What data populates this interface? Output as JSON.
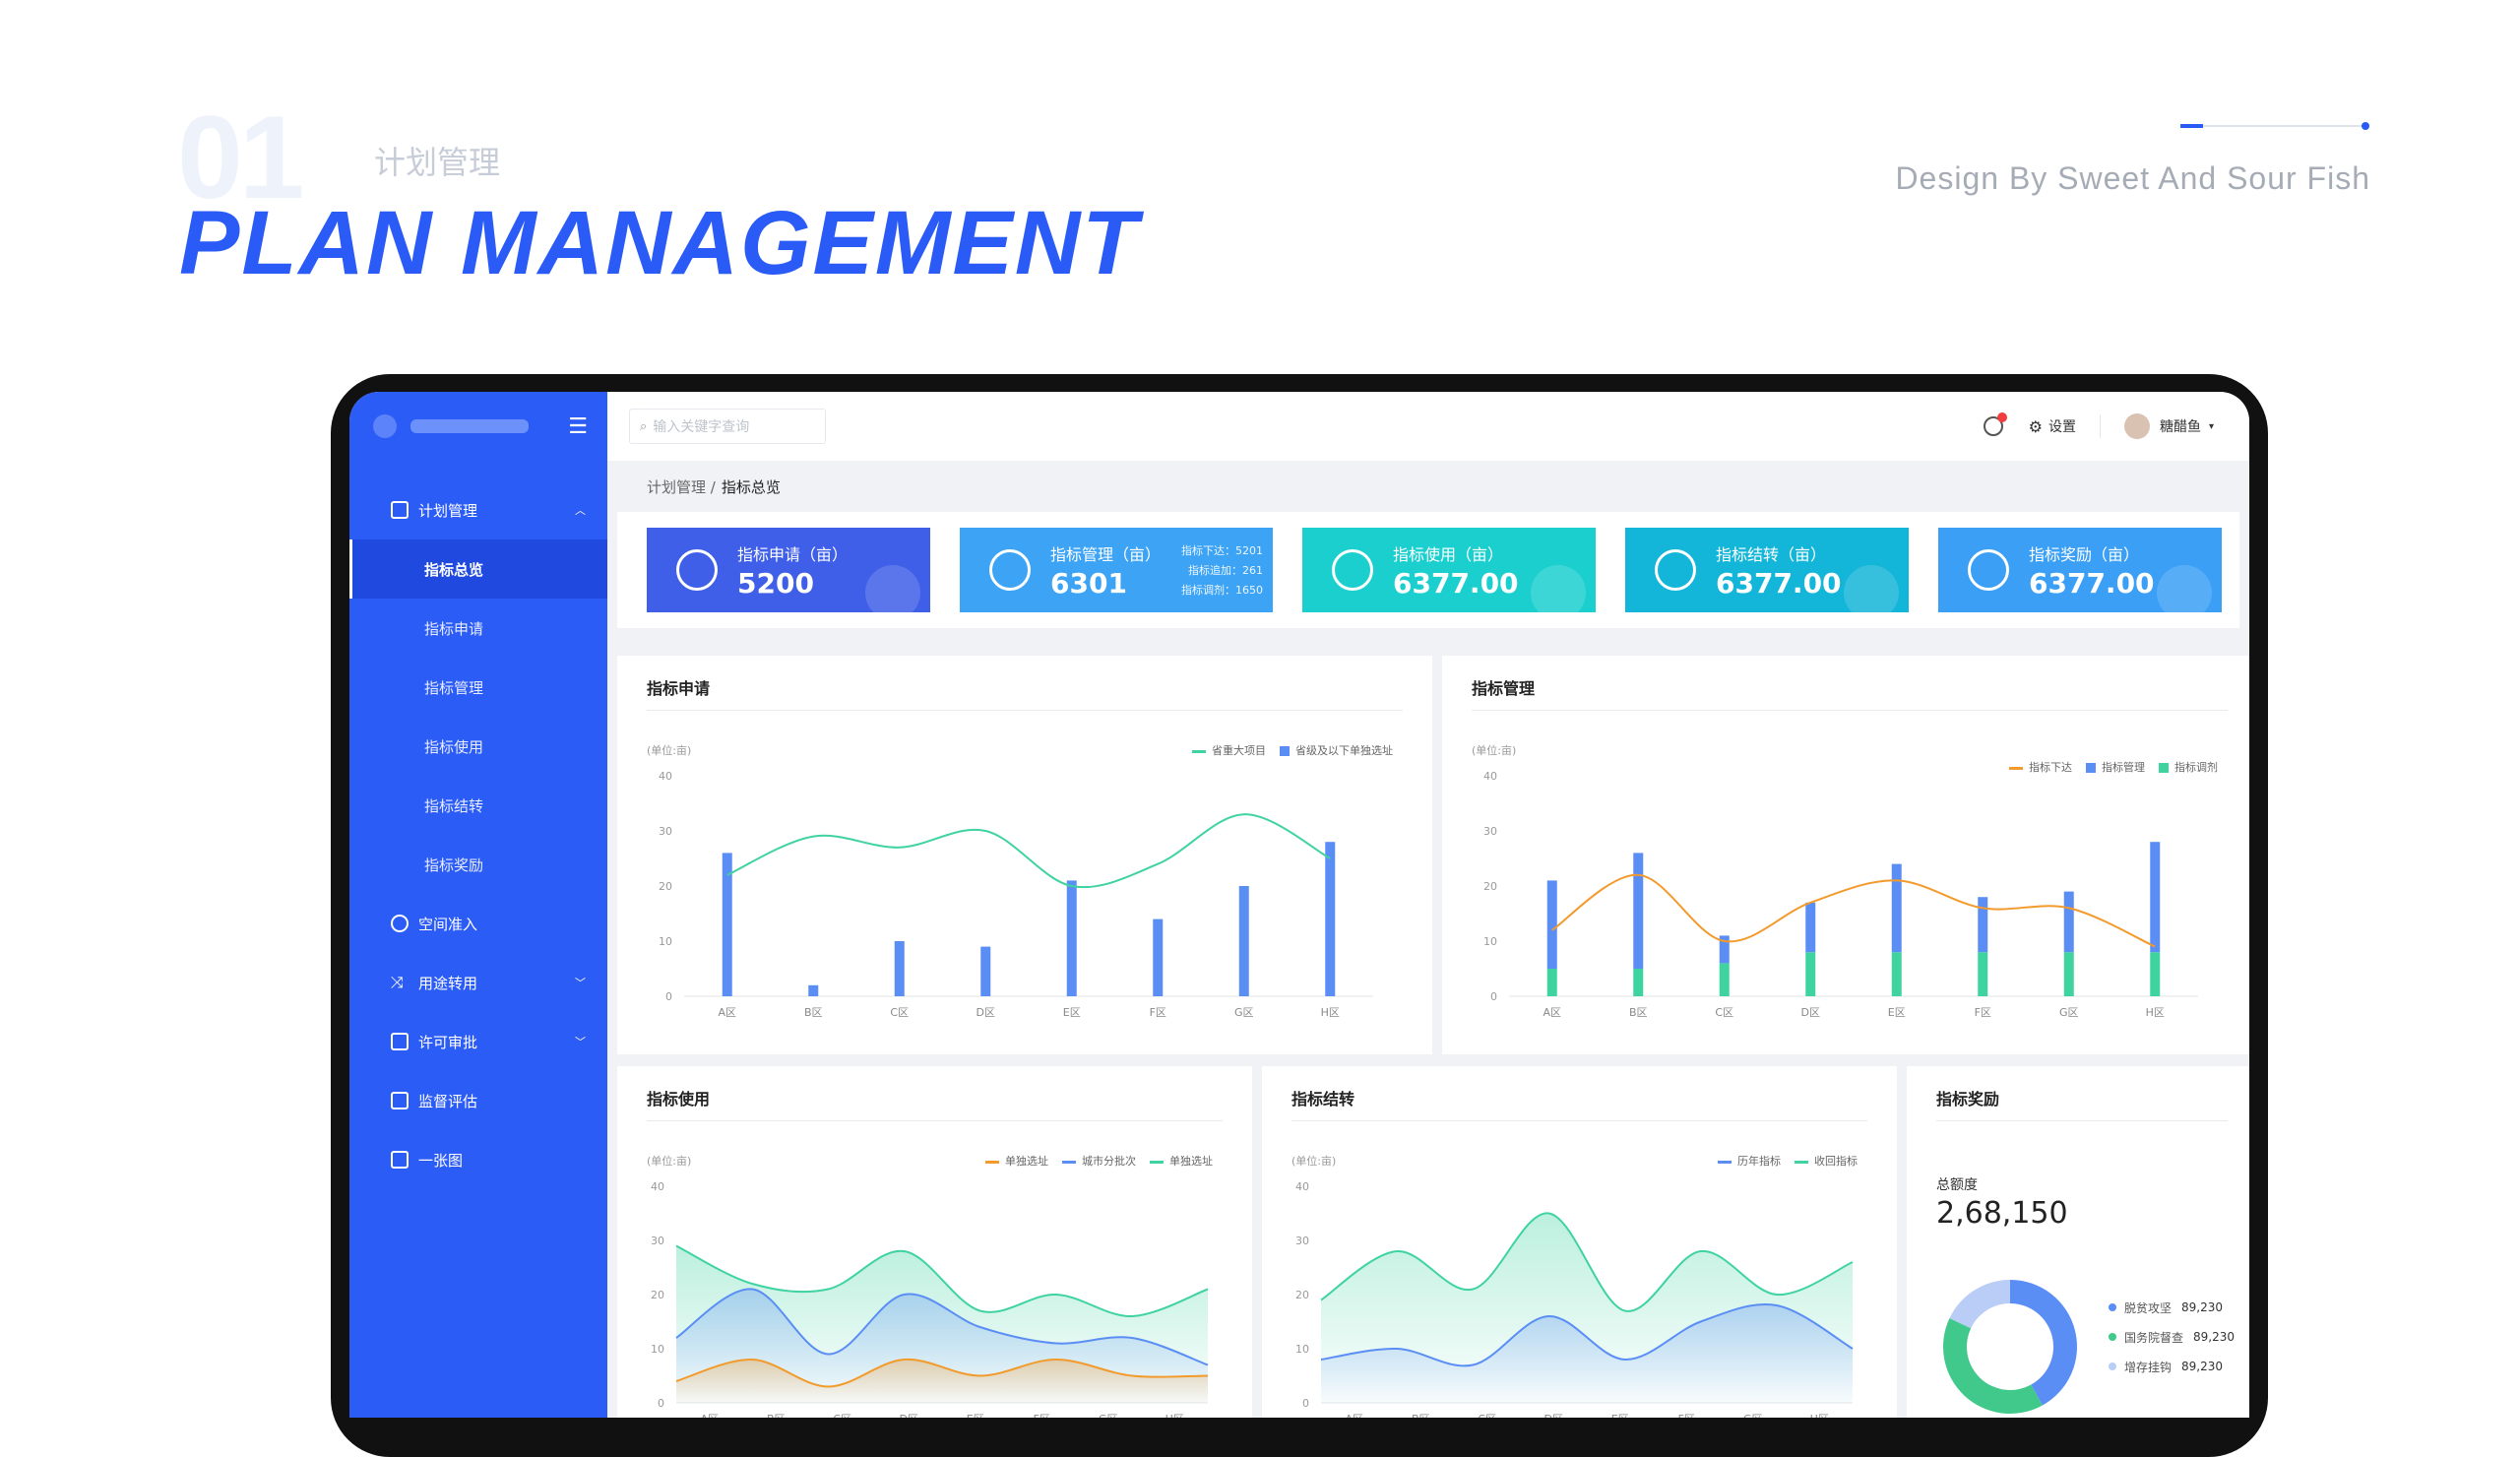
{
  "hero": {
    "number": "01",
    "subtitle": "计划管理",
    "title": "PLAN MANAGEMENT",
    "design_by": "Design By Sweet And Sour Fish",
    "progress": 0.12
  },
  "sidebar": {
    "items": [
      {
        "label": "计划管理",
        "expanded": true,
        "children": [
          "指标总览",
          "指标申请",
          "指标管理",
          "指标使用",
          "指标结转",
          "指标奖励"
        ],
        "active_child": "指标总览"
      },
      {
        "label": "空间准入"
      },
      {
        "label": "用途转用",
        "has_children": true
      },
      {
        "label": "许可审批",
        "has_children": true
      },
      {
        "label": "监督评估"
      },
      {
        "label": "一张图"
      }
    ]
  },
  "topbar": {
    "search_placeholder": "输入关键字查询",
    "settings_label": "设置",
    "user_name": "糖醋鱼"
  },
  "breadcrumb": {
    "parent": "计划管理 /",
    "current": "指标总览"
  },
  "stats": [
    {
      "title": "指标申请（亩）",
      "value": "5200",
      "color": "#3f5fe8",
      "icon": "user-clock-icon"
    },
    {
      "title": "指标管理（亩）",
      "value": "6301",
      "color": "#3ca3f5",
      "icon": "user-gear-icon",
      "extra": [
        "指标下达：5201",
        "指标追加：261",
        "指标调剂：1650"
      ]
    },
    {
      "title": "指标使用（亩）",
      "value": "6377.00",
      "color": "#1ccfcf",
      "icon": "map-icon"
    },
    {
      "title": "指标结转（亩）",
      "value": "6377.00",
      "color": "#13b5d8",
      "icon": "transfer-icon"
    },
    {
      "title": "指标奖励（亩）",
      "value": "6377.00",
      "color": "#3a9ff5",
      "icon": "award-icon"
    }
  ],
  "panels": {
    "apply": {
      "title": "指标申请",
      "unit": "(单位:亩)",
      "legend": [
        "省重大项目",
        "省级及以下单独选址"
      ]
    },
    "manage": {
      "title": "指标管理",
      "unit": "(单位:亩)",
      "legend": [
        "指标下达",
        "指标管理",
        "指标调剂"
      ]
    },
    "use": {
      "title": "指标使用",
      "unit": "(单位:亩)",
      "legend": [
        "单独选址",
        "城市分批次",
        "单独选址"
      ]
    },
    "carry": {
      "title": "指标结转",
      "unit": "(单位:亩)",
      "legend": [
        "历年指标",
        "收回指标"
      ]
    },
    "reward": {
      "title": "指标奖励",
      "total_label": "总额度",
      "total_value": "2,68,150",
      "legend": [
        {
          "name": "脱贫攻坚",
          "value": "89,230",
          "color": "#5b8ef5"
        },
        {
          "name": "国务院督查",
          "value": "89,230",
          "color": "#40c98a"
        },
        {
          "name": "增存挂钩",
          "value": "89,230",
          "color": "#b9cdf7"
        }
      ]
    }
  },
  "chart_data": [
    {
      "type": "bar",
      "title": "指标申请",
      "categories": [
        "A区",
        "B区",
        "C区",
        "D区",
        "E区",
        "F区",
        "G区",
        "H区"
      ],
      "ylim": [
        0,
        40
      ],
      "yticks": [
        0,
        10,
        20,
        30,
        40
      ],
      "series": [
        {
          "name": "省重大项目",
          "kind": "line",
          "values": [
            22,
            29,
            27,
            30,
            20,
            24,
            33,
            25
          ],
          "color": "#3fd3a0"
        },
        {
          "name": "省级及以下单独选址",
          "kind": "bar",
          "values": [
            26,
            2,
            10,
            9,
            21,
            14,
            20,
            28
          ],
          "color": "#5b8ef5"
        }
      ]
    },
    {
      "type": "bar",
      "title": "指标管理",
      "categories": [
        "A区",
        "B区",
        "C区",
        "D区",
        "E区",
        "F区",
        "G区",
        "H区"
      ],
      "ylim": [
        0,
        40
      ],
      "yticks": [
        0,
        10,
        20,
        30,
        40
      ],
      "stacked": true,
      "series": [
        {
          "name": "指标下达",
          "kind": "line",
          "values": [
            12,
            22,
            10,
            17,
            21,
            16,
            16,
            9
          ],
          "color": "#f39a2c"
        },
        {
          "name": "指标管理",
          "kind": "bar",
          "values": [
            16,
            21,
            5,
            9,
            16,
            10,
            11,
            20
          ],
          "color": "#5b8ef5"
        },
        {
          "name": "指标调剂",
          "kind": "bar",
          "values": [
            5,
            5,
            6,
            8,
            8,
            8,
            8,
            8
          ],
          "color": "#3fd3a0"
        }
      ]
    },
    {
      "type": "area",
      "title": "指标使用",
      "categories": [
        "A区",
        "B区",
        "C区",
        "D区",
        "E区",
        "F区",
        "G区",
        "H区"
      ],
      "ylim": [
        0,
        40
      ],
      "yticks": [
        0,
        10,
        20,
        30,
        40
      ],
      "series": [
        {
          "name": "单独选址",
          "values": [
            4,
            8,
            3,
            8,
            5,
            8,
            5,
            5
          ],
          "color": "#f39a2c"
        },
        {
          "name": "城市分批次",
          "values": [
            12,
            21,
            9,
            20,
            14,
            11,
            12,
            7
          ],
          "color": "#5b8ef5"
        },
        {
          "name": "单独选址",
          "values": [
            29,
            22,
            21,
            28,
            17,
            20,
            16,
            21
          ],
          "color": "#3fd3a0"
        }
      ]
    },
    {
      "type": "area",
      "title": "指标结转",
      "categories": [
        "A区",
        "B区",
        "C区",
        "D区",
        "E区",
        "F区",
        "G区",
        "H区"
      ],
      "ylim": [
        0,
        40
      ],
      "yticks": [
        0,
        10,
        20,
        30,
        40
      ],
      "series": [
        {
          "name": "历年指标",
          "values": [
            8,
            10,
            7,
            16,
            8,
            15,
            18,
            10
          ],
          "color": "#5b8ef5"
        },
        {
          "name": "收回指标",
          "values": [
            19,
            28,
            21,
            35,
            17,
            28,
            20,
            26
          ],
          "color": "#3fd3a0"
        }
      ]
    },
    {
      "type": "pie",
      "title": "指标奖励",
      "donut": true,
      "labels": [
        "脱贫攻坚",
        "国务院督查",
        "增存挂钩"
      ],
      "values": [
        89230,
        89230,
        89230
      ],
      "display_fraction": [
        0.42,
        0.4,
        0.18
      ],
      "colors": [
        "#5b8ef5",
        "#40c98a",
        "#b9cdf7"
      ]
    }
  ]
}
